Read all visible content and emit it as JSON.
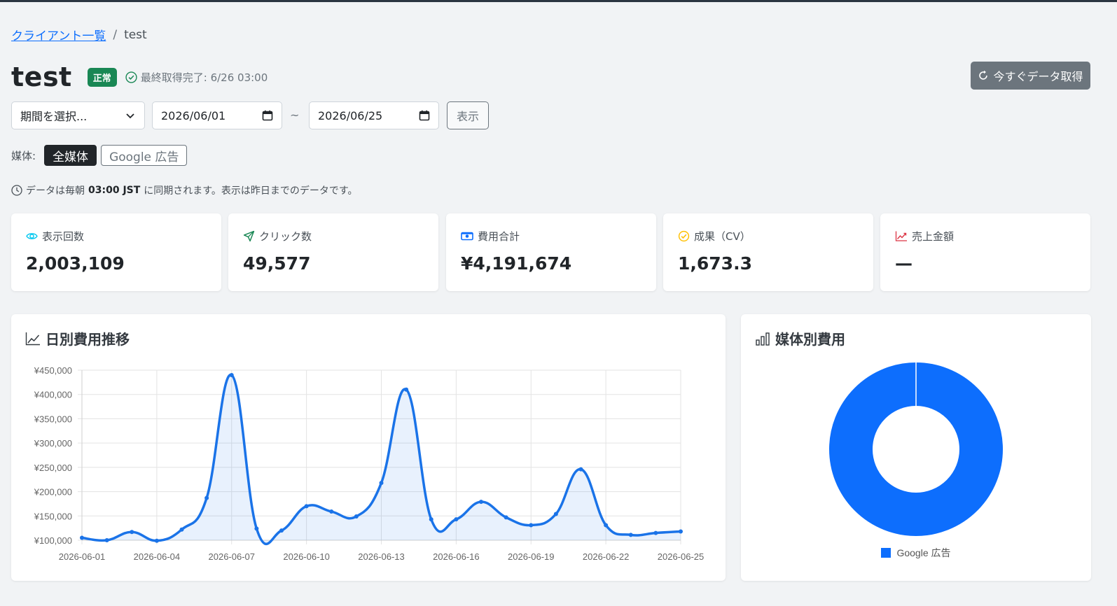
{
  "breadcrumb": {
    "link": "クライアント一覧",
    "sep": "/",
    "current": "test"
  },
  "header": {
    "title": "test",
    "status_badge": "正常",
    "last_fetch": "最終取得完了: 6/26 03:00",
    "fetch_button": "今すぐデータ取得"
  },
  "filters": {
    "period_select": "期間を選択...",
    "start_date": "2026/06/01",
    "tilde": "~",
    "end_date": "2026/06/25",
    "show_button": "表示"
  },
  "media": {
    "label": "媒体:",
    "options": [
      "全媒体",
      "Google 広告"
    ],
    "selected": "全媒体"
  },
  "info": {
    "prefix": "データは毎朝",
    "time": "03:00 JST",
    "suffix": "に同期されます。表示は昨日までのデータです。"
  },
  "kpis": [
    {
      "label": "表示回数",
      "value": "2,003,109",
      "icon": "eye-icon",
      "color": "#0dcaf0"
    },
    {
      "label": "クリック数",
      "value": "49,577",
      "icon": "cursor-icon",
      "color": "#198754"
    },
    {
      "label": "費用合計",
      "value": "¥4,191,674",
      "icon": "cash-icon",
      "color": "#0d6efd"
    },
    {
      "label": "成果（CV）",
      "value": "1,673.3",
      "icon": "check-circle-icon",
      "color": "#ffc107"
    },
    {
      "label": "売上金額",
      "value": "—",
      "icon": "graph-up-icon",
      "color": "#dc3545"
    }
  ],
  "line_card": {
    "title": "日別費用推移"
  },
  "pie_card": {
    "title": "媒体別費用"
  },
  "chart_data": [
    {
      "type": "line",
      "title": "日別費用推移",
      "x": [
        "2026-06-01",
        "2026-06-02",
        "2026-06-03",
        "2026-06-04",
        "2026-06-05",
        "2026-06-06",
        "2026-06-07",
        "2026-06-08",
        "2026-06-09",
        "2026-06-10",
        "2026-06-11",
        "2026-06-12",
        "2026-06-13",
        "2026-06-14",
        "2026-06-15",
        "2026-06-16",
        "2026-06-17",
        "2026-06-18",
        "2026-06-19",
        "2026-06-20",
        "2026-06-21",
        "2026-06-22",
        "2026-06-23",
        "2026-06-24",
        "2026-06-25"
      ],
      "tick_labels": [
        "2026-06-01",
        "2026-06-04",
        "2026-06-07",
        "2026-06-10",
        "2026-06-13",
        "2026-06-16",
        "2026-06-19",
        "2026-06-22",
        "2026-06-25"
      ],
      "values": [
        105000,
        100000,
        117000,
        99000,
        122000,
        187000,
        440000,
        124000,
        120000,
        170000,
        159000,
        149000,
        218000,
        410000,
        143000,
        143000,
        179000,
        147000,
        131000,
        154000,
        246000,
        131000,
        111000,
        115000,
        118000
      ],
      "ylim": [
        100000,
        450000
      ],
      "y_ticks": [
        "¥100,000",
        "¥150,000",
        "¥200,000",
        "¥250,000",
        "¥300,000",
        "¥350,000",
        "¥400,000",
        "¥450,000"
      ],
      "grid": true,
      "color": "#1a73e8"
    },
    {
      "type": "pie",
      "title": "媒体別費用",
      "donut": true,
      "labels": [
        "Google 広告"
      ],
      "values": [
        4191674
      ],
      "legend_position": "bottom",
      "colors": [
        "#0d6efd"
      ]
    }
  ]
}
